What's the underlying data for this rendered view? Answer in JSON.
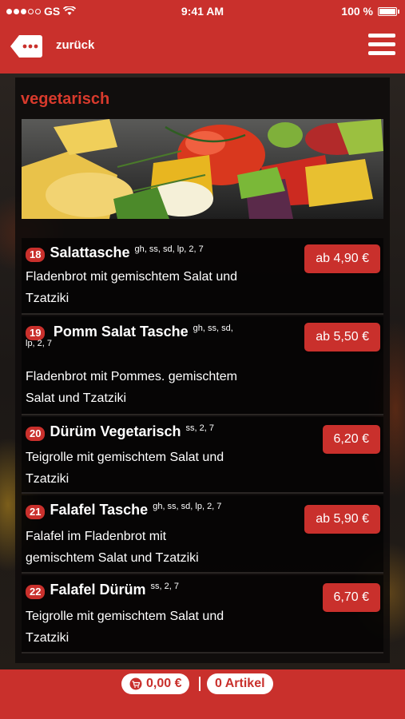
{
  "status_bar": {
    "carrier": "GS",
    "time": "9:41 AM",
    "battery": "100 %"
  },
  "nav": {
    "back_label": "zurück"
  },
  "section": {
    "title": "vegetarisch"
  },
  "items": [
    {
      "number": "18",
      "name": "Salattasche",
      "allergens": "gh, ss, sd, lp, 2, 7",
      "desc_lines": [
        "Fladenbrot mit gemischtem Salat und",
        "Tzatziki"
      ],
      "price": "ab 4,90 €"
    },
    {
      "number": "19",
      "name": "Pomm Salat Tasche",
      "allergens": "gh, ss, sd,",
      "allergens_line2": "lp, 2, 7",
      "desc_lines": [
        "Fladenbrot mit Pommes. gemischtem",
        "Salat und Tzatziki"
      ],
      "price": "ab 5,50 €"
    },
    {
      "number": "20",
      "name": "Dürüm Vegetarisch",
      "allergens": "ss, 2, 7",
      "desc_lines": [
        "Teigrolle mit gemischtem Salat und",
        "Tzatziki"
      ],
      "price": "6,20 €"
    },
    {
      "number": "21",
      "name": "Falafel Tasche",
      "allergens": "gh, ss, sd, lp, 2, 7",
      "desc_lines": [
        "Falafel im Fladenbrot mit",
        "gemischtem Salat und Tzatziki"
      ],
      "price": "ab 5,90 €"
    },
    {
      "number": "22",
      "name": "Falafel Dürüm",
      "allergens": "ss, 2, 7",
      "desc_lines": [
        "Teigrolle mit gemischtem Salat und",
        "Tzatziki"
      ],
      "price": "6,70 €"
    }
  ],
  "footer": {
    "cart_total": "0,00 €",
    "separator": "|",
    "articles": "0 Artikel"
  },
  "colors": {
    "accent": "#c9302c",
    "section_title": "#d83a2c"
  }
}
